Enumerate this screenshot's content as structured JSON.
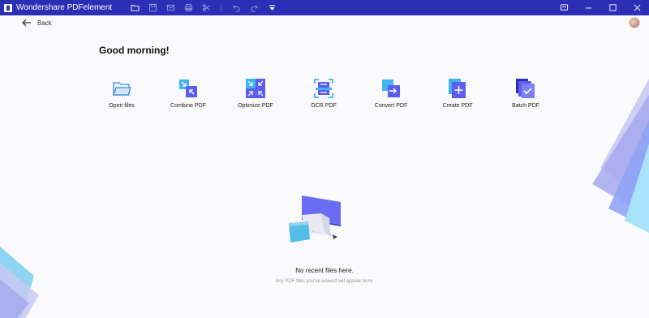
{
  "app": {
    "title": "Wondershare PDFelement"
  },
  "toolbar": {
    "icons": [
      "folder-icon",
      "save-icon",
      "mail-icon",
      "print-icon",
      "scissors-icon",
      "undo-icon",
      "redo-icon",
      "dropdown-icon"
    ],
    "window_controls": [
      "feedback-icon",
      "minimize-icon",
      "maximize-icon",
      "close-icon"
    ]
  },
  "nav": {
    "back_label": "Back"
  },
  "greeting": "Good morning!",
  "tools": [
    {
      "label": "Open files",
      "icon": "folder-open-icon"
    },
    {
      "label": "Combine PDF",
      "icon": "combine-icon"
    },
    {
      "label": "Optimize PDF",
      "icon": "optimize-icon"
    },
    {
      "label": "OCR PDF",
      "icon": "ocr-icon"
    },
    {
      "label": "Convert PDF",
      "icon": "convert-icon"
    },
    {
      "label": "Create PDF",
      "icon": "create-icon"
    },
    {
      "label": "Batch PDF",
      "icon": "batch-icon"
    }
  ],
  "empty_state": {
    "title": "No recent files here.",
    "subtitle": "Any PDF files you've viewed will appear here."
  },
  "colors": {
    "titlebar": "#2c2fb5",
    "accent": "#5b5ef0",
    "background": "#fafafc"
  }
}
